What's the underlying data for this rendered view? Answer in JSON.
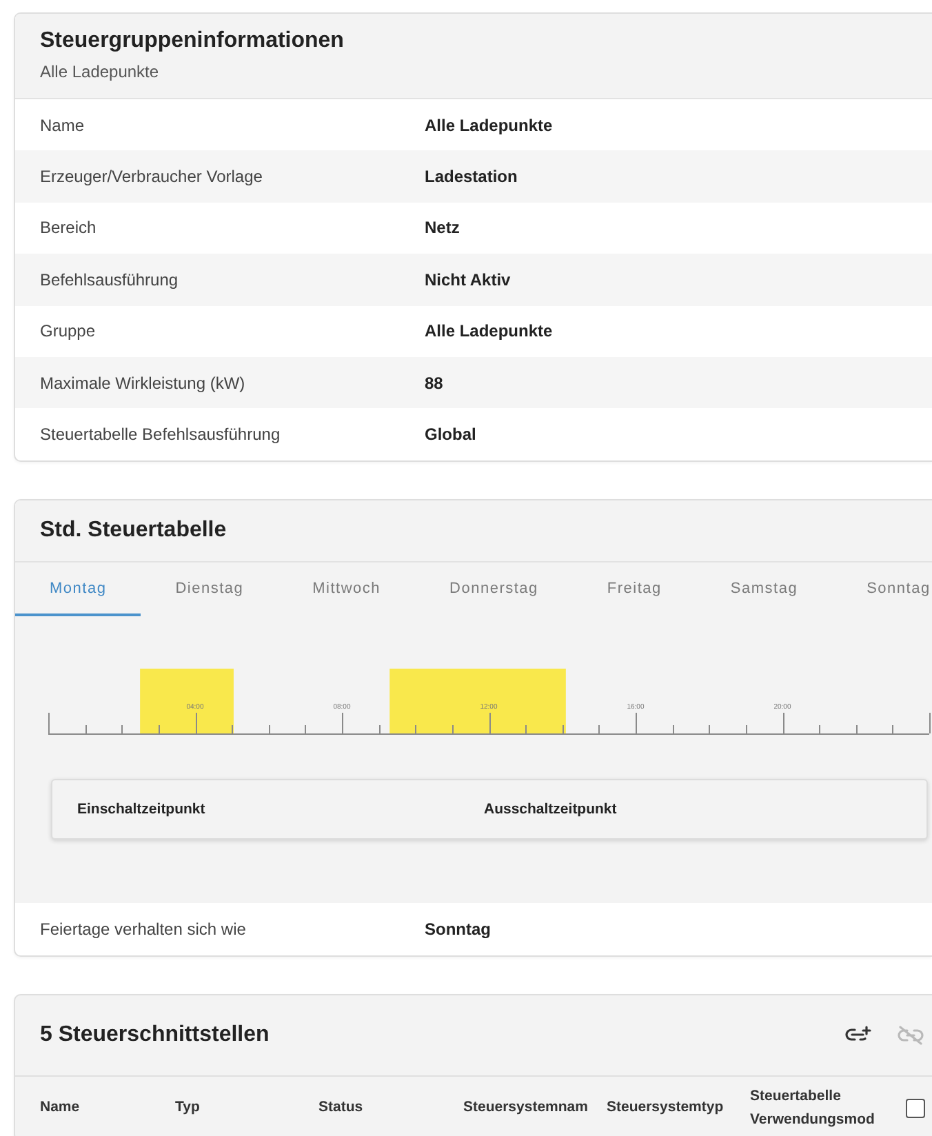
{
  "group_info": {
    "title": "Steuergruppeninformationen",
    "subtitle": "Alle Ladepunkte",
    "rows": [
      {
        "label": "Name",
        "value": "Alle Ladepunkte"
      },
      {
        "label": "Erzeuger/Verbraucher Vorlage",
        "value": "Ladestation"
      },
      {
        "label": "Bereich",
        "value": "Netz"
      },
      {
        "label": "Befehlsausführung",
        "value": "Nicht Aktiv"
      },
      {
        "label": "Gruppe",
        "value": "Alle Ladepunkte"
      },
      {
        "label": "Maximale Wirkleistung (kW)",
        "value": "88"
      },
      {
        "label": "Steuertabelle Befehlsausführung",
        "value": "Global"
      }
    ]
  },
  "schedule": {
    "title": "Std. Steuertabelle",
    "tabs": [
      {
        "label": "Montag",
        "selected": true
      },
      {
        "label": "Dienstag",
        "selected": false
      },
      {
        "label": "Mittwoch",
        "selected": false
      },
      {
        "label": "Donnerstag",
        "selected": false
      },
      {
        "label": "Freitag",
        "selected": false
      },
      {
        "label": "Samstag",
        "selected": false
      },
      {
        "label": "Sonntag",
        "selected": false
      }
    ],
    "timeline": {
      "tick_labels": [
        "04:00",
        "08:00",
        "12:00",
        "16:00",
        "20:00"
      ]
    },
    "columns": [
      "Einschaltzeitpunkt",
      "Ausschaltzeitpunkt"
    ],
    "holiday": {
      "label": "Feiertage verhalten sich wie",
      "value": "Sonntag"
    }
  },
  "interfaces": {
    "title": "5 Steuerschnittstellen",
    "actions": [
      {
        "kind": "link-add",
        "disabled": false
      },
      {
        "kind": "unlink",
        "disabled": true
      }
    ],
    "columns": [
      "Name",
      "Typ",
      "Status",
      "Steuersystemnam",
      "Steuersystemtyp",
      "Steuertabelle Verwendungsmod"
    ],
    "select_all": {
      "checked": false
    }
  }
}
